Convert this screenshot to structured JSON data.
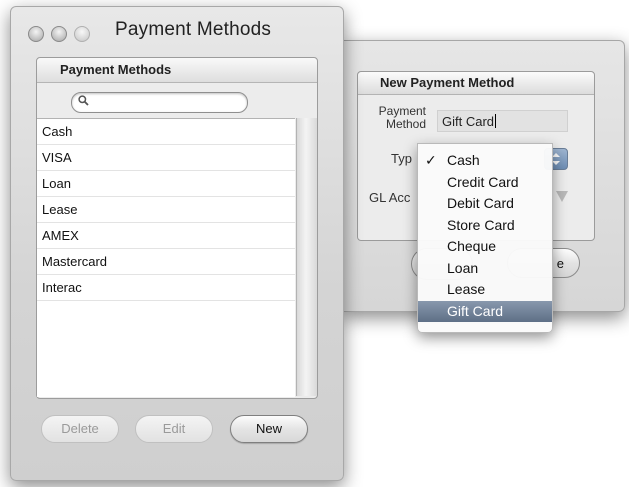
{
  "window": {
    "title": "Payment Methods"
  },
  "list": {
    "header": "Payment Methods",
    "search_placeholder": "",
    "items": [
      "Cash",
      "VISA",
      "Loan",
      "Lease",
      "AMEX",
      "Mastercard",
      "Interac"
    ]
  },
  "buttons": {
    "delete": "Delete",
    "edit": "Edit",
    "new": "New"
  },
  "form": {
    "group_title": "New Payment Method",
    "payment_method_label_line1": "Payment",
    "payment_method_label_line2": "Method",
    "payment_method_value": "Gift Card",
    "type_label": "Typ",
    "gl_label": "GL Acc",
    "right_button_visible_text": "e"
  },
  "type_menu": {
    "options": [
      "Cash",
      "Credit Card",
      "Debit Card",
      "Store Card",
      "Cheque",
      "Loan",
      "Lease",
      "Gift Card"
    ],
    "checked": "Cash",
    "highlighted": "Gift Card",
    "check_glyph": "✓"
  },
  "colors": {
    "menu_highlight": "#6b7c93",
    "popup_button": "#7f9cc2"
  },
  "icons": {
    "search": "magnifier-icon",
    "traffic_lights": "window-buttons"
  }
}
